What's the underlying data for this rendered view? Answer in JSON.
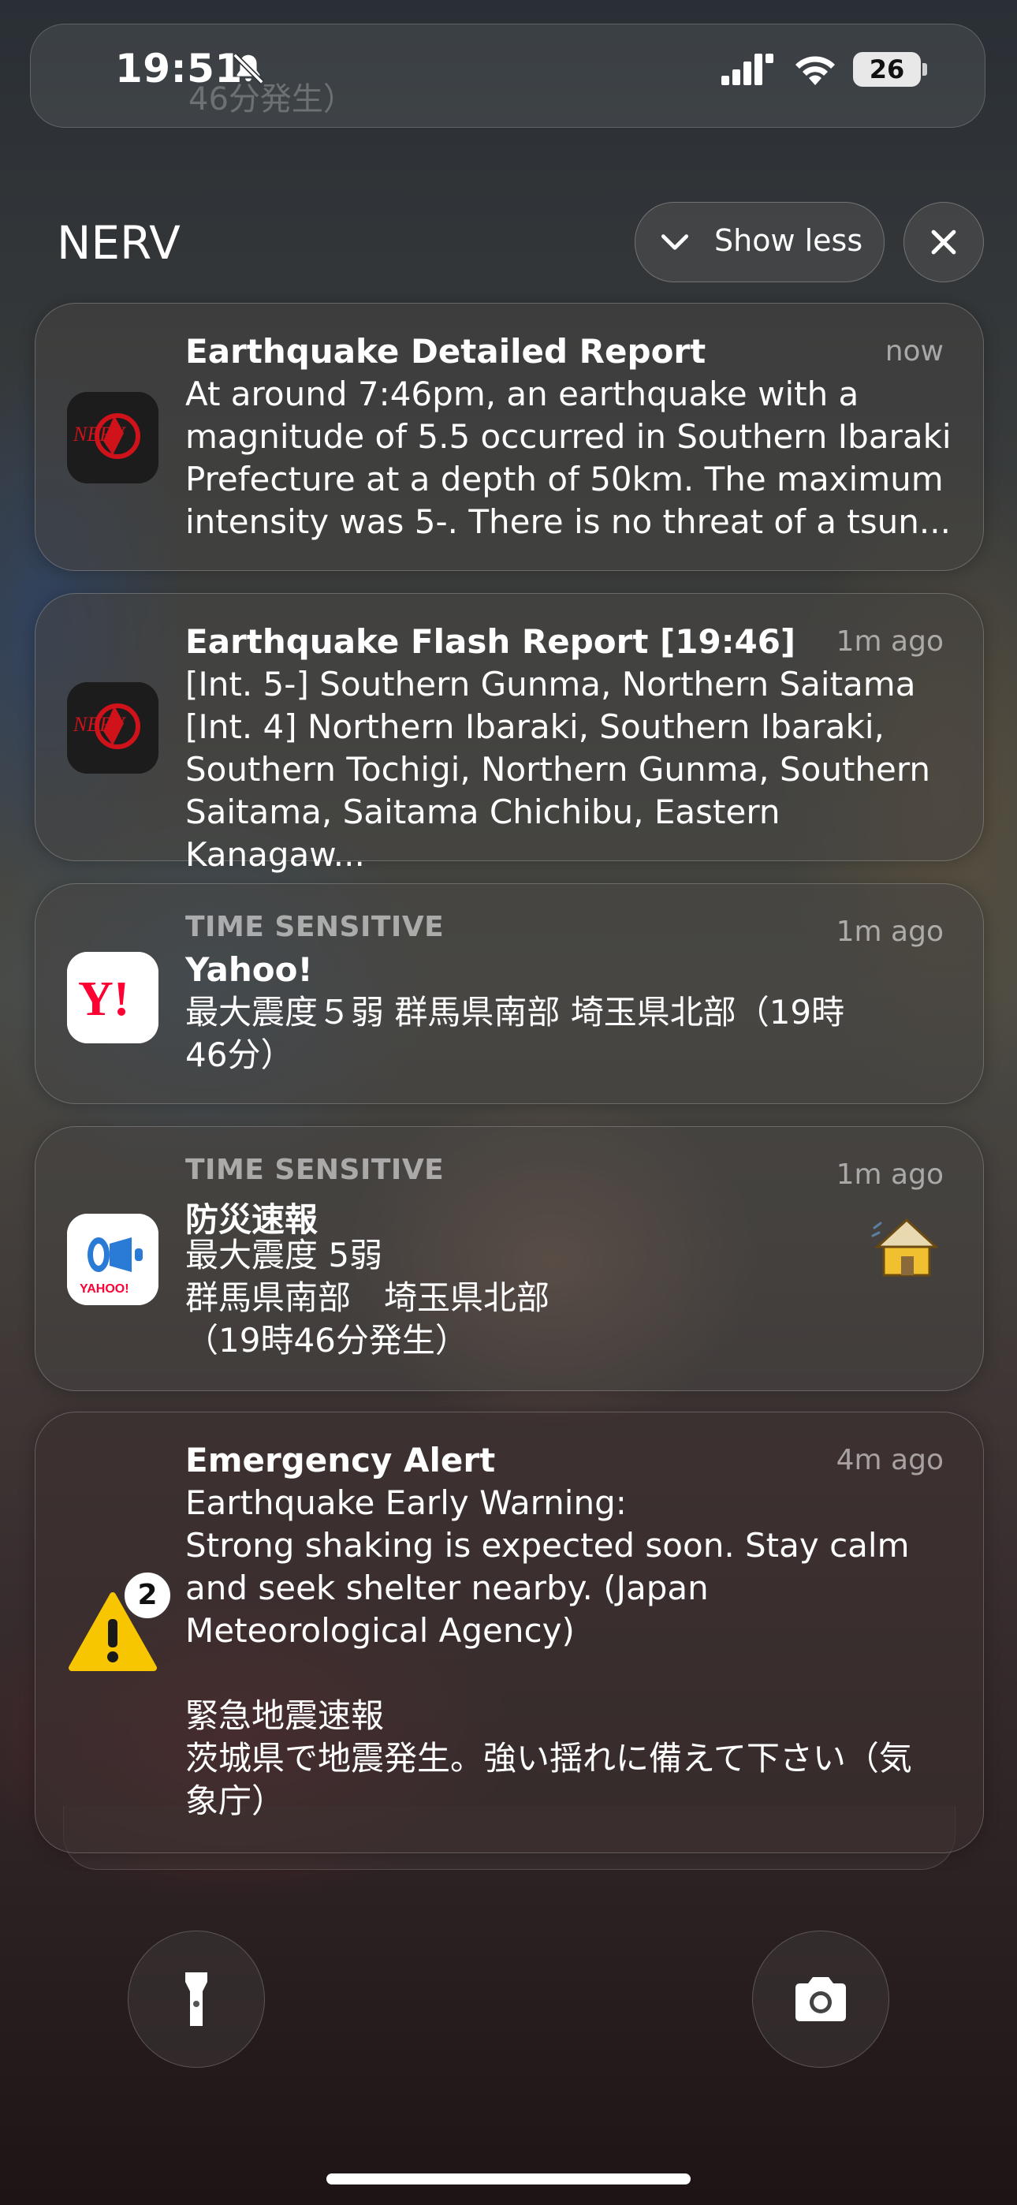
{
  "status_bar": {
    "time": "19:51",
    "battery": "26",
    "silent_icon": "bell-slash-icon",
    "signal_icon": "cellular-signal-icon",
    "wifi_icon": "wifi-icon"
  },
  "background_text": "46分発生）",
  "group": {
    "app_name": "NERV",
    "show_less_label": "Show less",
    "close_icon": "close-icon"
  },
  "notifications": [
    {
      "app": "NERV",
      "icon": "nerv-app-icon",
      "title": "Earthquake Detailed Report",
      "time": "now",
      "body": "At around 7:46pm, an earthquake with a\nmagnitude of 5.5 occurred in Southern Ibaraki\nPrefecture at a depth of 50km. The maximum\nintensity was 5-. There is no threat of a tsun..."
    },
    {
      "app": "NERV",
      "icon": "nerv-app-icon",
      "title": "Earthquake Flash Report [19:46]",
      "time": "1m ago",
      "body": "[Int. 5-] Southern Gunma, Northern Saitama\n[Int. 4] Northern Ibaraki, Southern Ibaraki,\nSouthern Tochigi, Northern Gunma, Southern\nSaitama, Saitama Chichibu, Eastern Kanagaw..."
    },
    {
      "app": "Yahoo!",
      "icon": "yahoo-app-icon",
      "tag": "TIME SENSITIVE",
      "title": "Yahoo!",
      "time": "1m ago",
      "body": "最大震度５弱 群馬県南部 埼玉県北部（19時\n46分）"
    },
    {
      "app": "防災速報",
      "icon": "yahoo-bosai-app-icon",
      "tag": "TIME SENSITIVE",
      "title": "防災速報",
      "time": "1m ago",
      "body": "最大震度 5弱\n群馬県南部　埼玉県北部\n（19時46分発生）",
      "attachment_icon": "house-shaking-icon"
    },
    {
      "app": "Emergency Alert",
      "icon": "warning-triangle-icon",
      "badge": "2",
      "title": "Emergency Alert",
      "time": "4m ago",
      "body": "Earthquake Early Warning:\nStrong shaking is expected soon. Stay calm\nand seek shelter nearby. (Japan\nMeteorological Agency)\n\n緊急地震速報\n茨城県で地震発生。強い揺れに備えて下さい（気\n象庁）"
    }
  ],
  "quick_actions": {
    "flashlight_icon": "flashlight-icon",
    "camera_icon": "camera-icon"
  },
  "colors": {
    "nerv_red": "#d0121b",
    "yahoo_red": "#ff0033",
    "warning_yellow": "#f7c600"
  }
}
